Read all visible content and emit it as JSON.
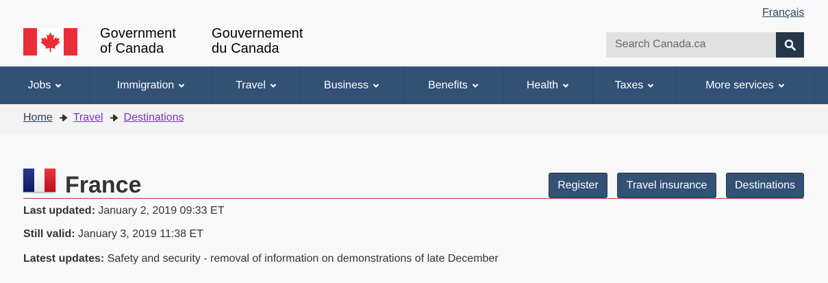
{
  "header": {
    "language_link": "Français",
    "signature_en": [
      "Government",
      "of Canada"
    ],
    "signature_fr": [
      "Gouvernement",
      "du Canada"
    ],
    "search_placeholder": "Search Canada.ca"
  },
  "nav": {
    "items": [
      {
        "label": "Jobs"
      },
      {
        "label": "Immigration"
      },
      {
        "label": "Travel"
      },
      {
        "label": "Business"
      },
      {
        "label": "Benefits"
      },
      {
        "label": "Health"
      },
      {
        "label": "Taxes"
      },
      {
        "label": "More services"
      }
    ]
  },
  "breadcrumb": {
    "items": [
      "Home",
      "Travel",
      "Destinations"
    ]
  },
  "page": {
    "title": "France",
    "actions": {
      "register": "Register",
      "insurance": "Travel insurance",
      "destinations": "Destinations"
    },
    "meta": {
      "last_updated_label": "Last updated:",
      "last_updated_value": "January 2, 2019 09:33 ET",
      "still_valid_label": "Still valid:",
      "still_valid_value": "January 3, 2019 11:38 ET",
      "latest_updates_label": "Latest updates:",
      "latest_updates_value": "Safety and security - removal of information on demonstrations of late December"
    }
  },
  "colors": {
    "nav_bg": "#335075",
    "accent_rule": "#af3c43",
    "visited_link": "#7834bc"
  }
}
